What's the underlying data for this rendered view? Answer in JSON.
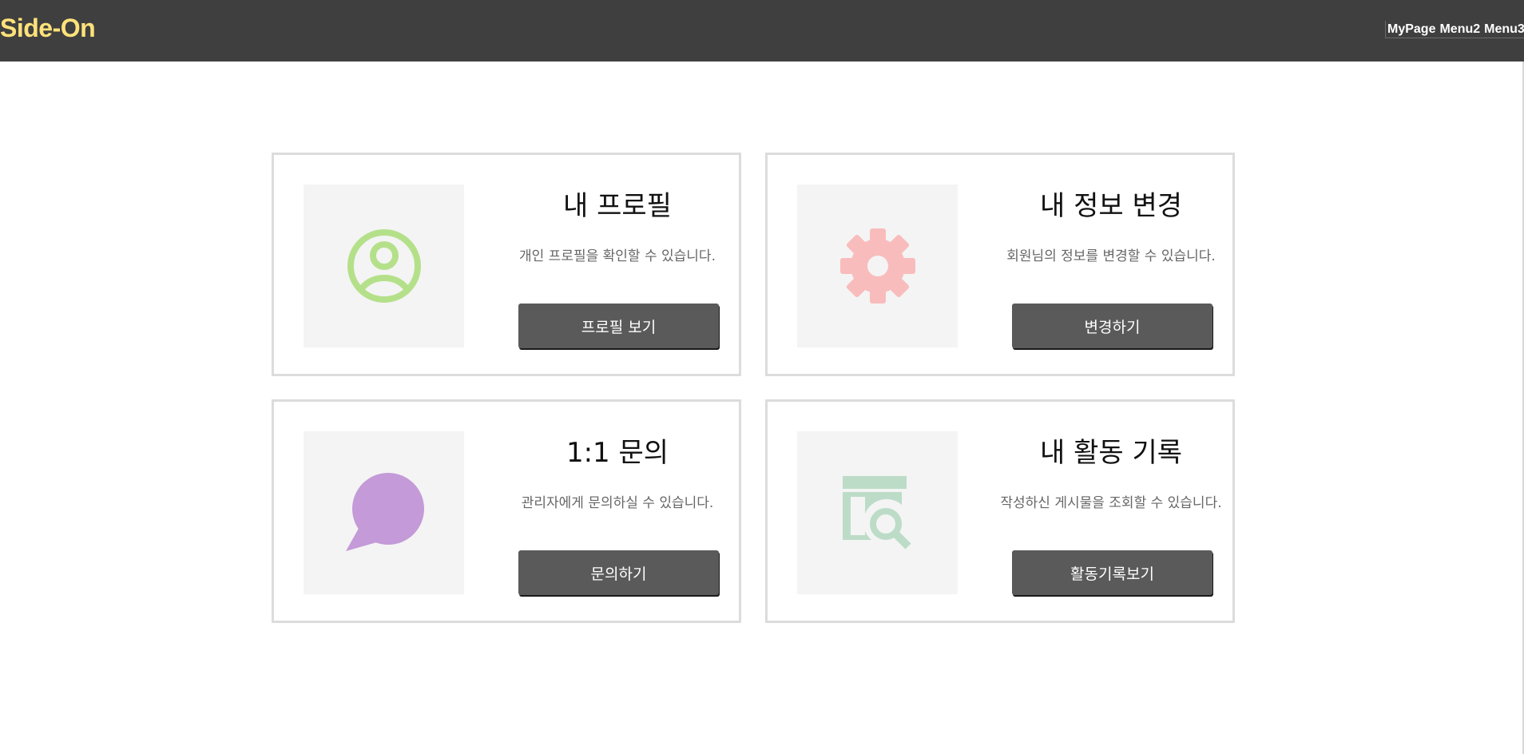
{
  "header": {
    "logo": "Side-On",
    "nav": [
      "MyPage",
      "Menu2",
      "Menu3"
    ]
  },
  "cards": [
    {
      "title": "내 프로필",
      "description": "개인 프로필을 확인할 수 있습니다.",
      "button": "프로필 보기",
      "icon": "user-circle-icon",
      "icon_color": "#b5e08a"
    },
    {
      "title": "내 정보 변경",
      "description": "회원님의 정보를 변경할 수 있습니다.",
      "button": "변경하기",
      "icon": "gear-icon",
      "icon_color": "#f9bcbc"
    },
    {
      "title": "1:1 문의",
      "description": "관리자에게 문의하실 수 있습니다.",
      "button": "문의하기",
      "icon": "chat-bubble-icon",
      "icon_color": "#c49ad8"
    },
    {
      "title": "내 활동 기록",
      "description": "작성하신 게시물을 조회할 수 있습니다.",
      "button": "활동기록보기",
      "icon": "document-search-icon",
      "icon_color": "#bcdcc8"
    }
  ]
}
